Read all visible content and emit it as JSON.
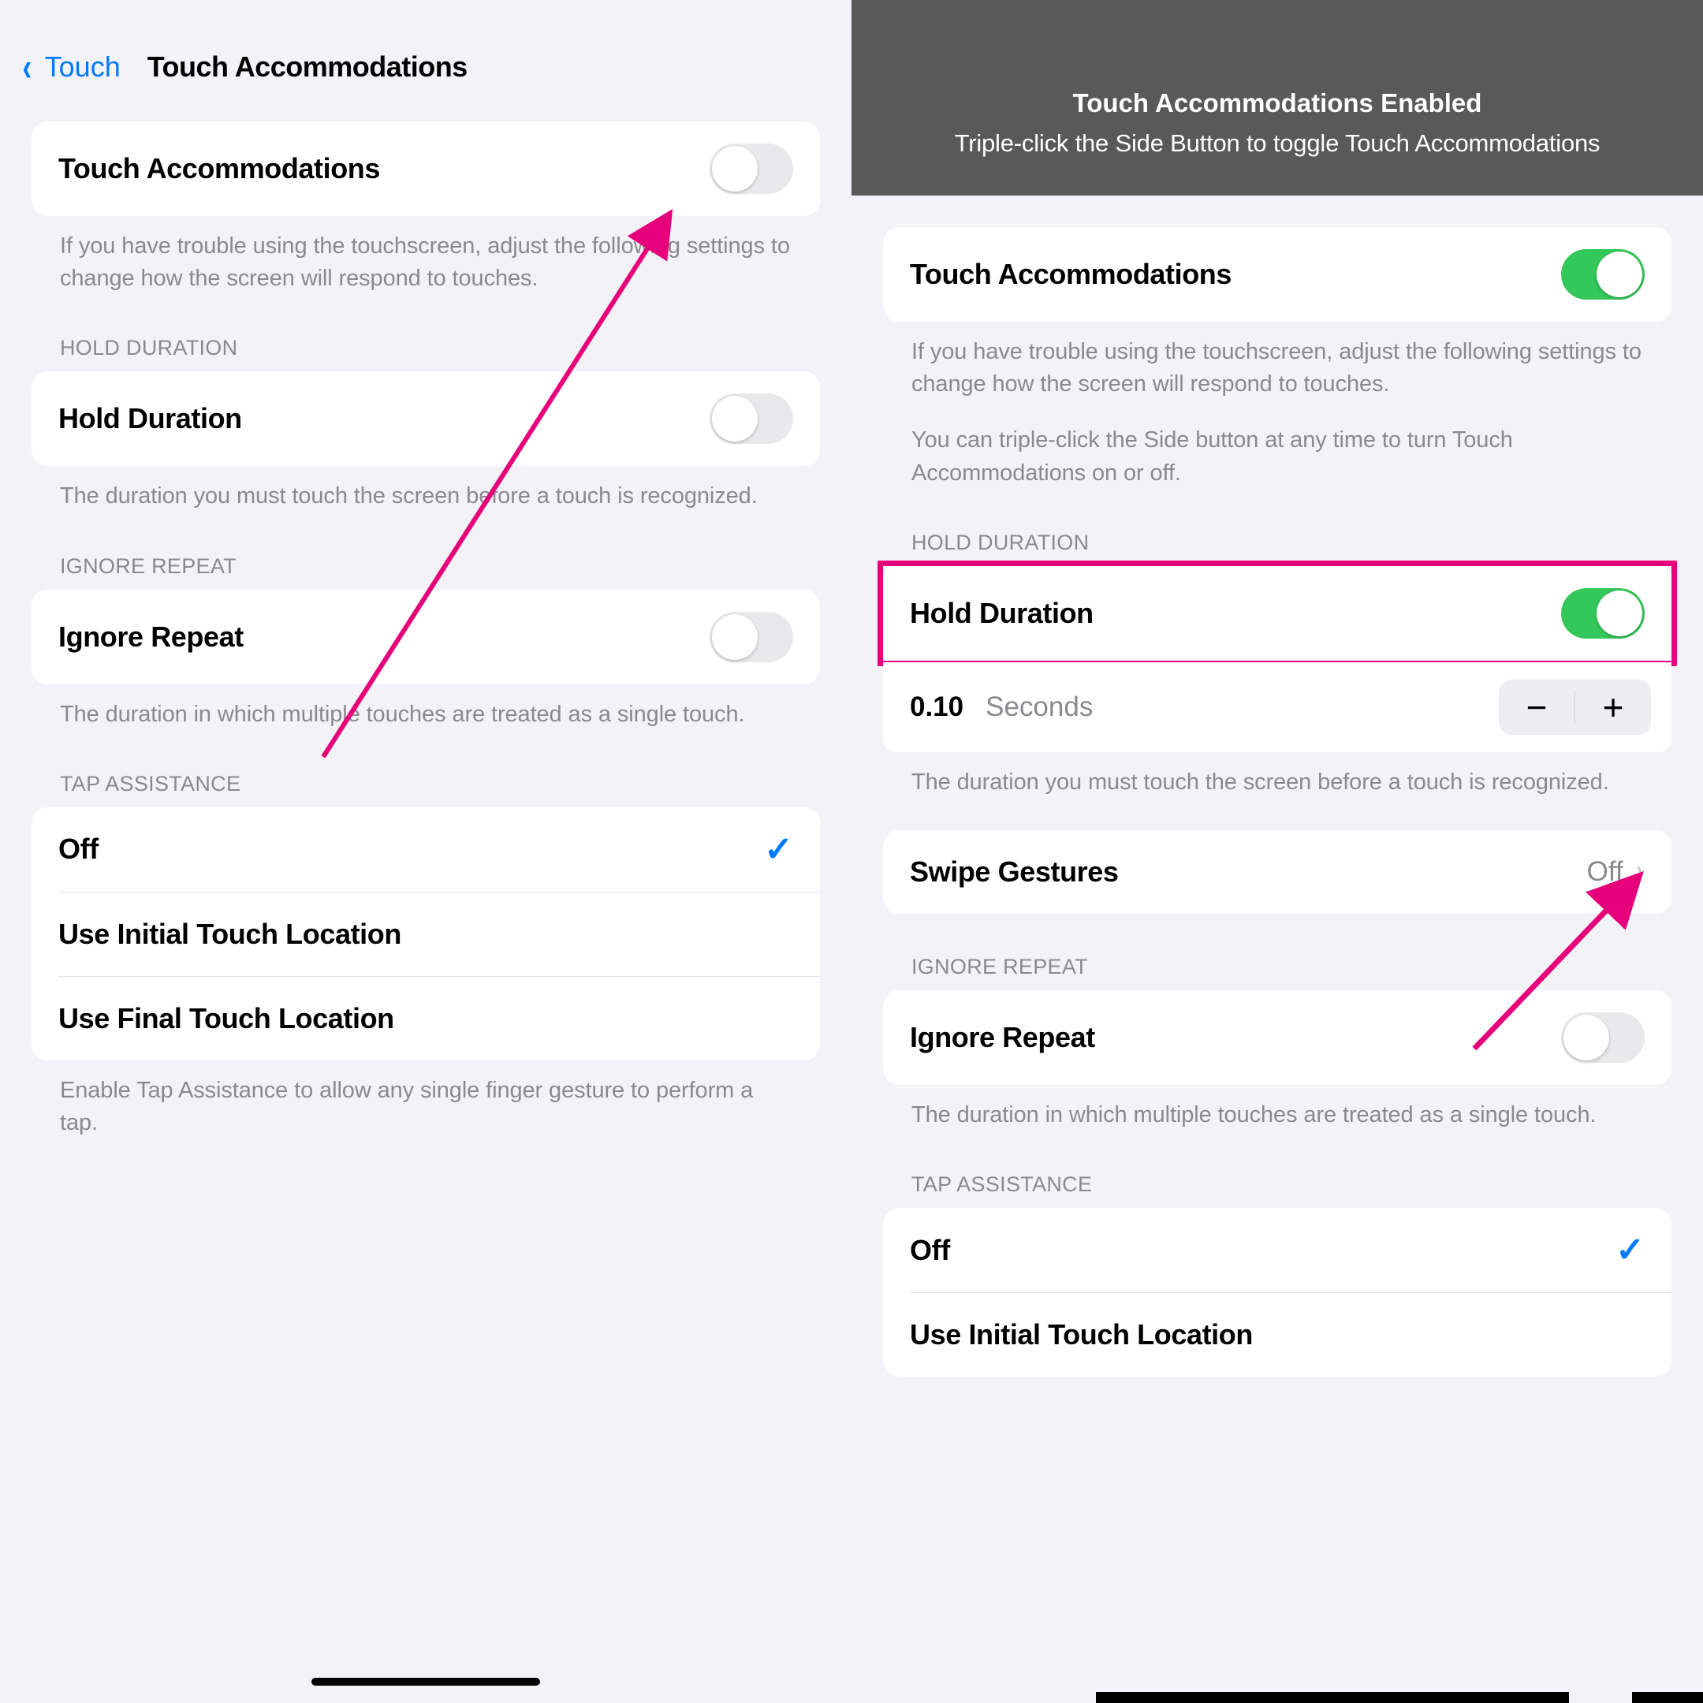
{
  "left": {
    "nav": {
      "back": "Touch",
      "title": "Touch Accommodations"
    },
    "main_toggle": {
      "label": "Touch Accommodations",
      "on": false,
      "footer": "If you have trouble using the touchscreen, adjust the following settings to change how the screen will respond to touches."
    },
    "hold": {
      "header": "HOLD DURATION",
      "label": "Hold Duration",
      "on": false,
      "footer": "The duration you must touch the screen before a touch is recognized."
    },
    "ignore": {
      "header": "IGNORE REPEAT",
      "label": "Ignore Repeat",
      "on": false,
      "footer": "The duration in which multiple touches are treated as a single touch."
    },
    "tap": {
      "header": "TAP ASSISTANCE",
      "options": [
        "Off",
        "Use Initial Touch Location",
        "Use Final Touch Location"
      ],
      "selected": 0,
      "footer": "Enable Tap Assistance to allow any single finger gesture to perform a tap."
    }
  },
  "right": {
    "banner": {
      "title": "Touch Accommodations Enabled",
      "sub": "Triple-click the Side Button to toggle Touch Accommodations"
    },
    "main_toggle": {
      "label": "Touch Accommodations",
      "on": true,
      "footer1": "If you have trouble using the touchscreen, adjust the following settings to change how the screen will respond to touches.",
      "footer2": "You can triple-click the Side button at any time to turn Touch Accommodations on or off."
    },
    "hold": {
      "header": "HOLD DURATION",
      "label": "Hold Duration",
      "on": true,
      "value": "0.10",
      "unit": "Seconds",
      "footer": "The duration you must touch the screen before a touch is recognized."
    },
    "swipe": {
      "label": "Swipe Gestures",
      "value": "Off"
    },
    "ignore": {
      "header": "IGNORE REPEAT",
      "label": "Ignore Repeat",
      "on": false,
      "footer": "The duration in which multiple touches are treated as a single touch."
    },
    "tap": {
      "header": "TAP ASSISTANCE",
      "options": [
        "Off",
        "Use Initial Touch Location"
      ],
      "selected": 0
    }
  }
}
